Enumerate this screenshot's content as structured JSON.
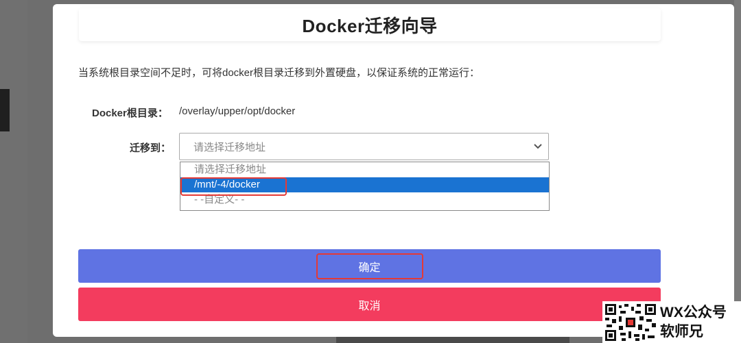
{
  "dialog": {
    "title": "Docker迁移向导",
    "description": "当系统根目录空间不足时，可将docker根目录迁移到外置硬盘，以保证系统的正常运行：",
    "root_label": "Docker根目录：",
    "root_value": "/overlay/upper/opt/docker",
    "migrate_label": "迁移到：",
    "select": {
      "placeholder": "请选择迁移地址",
      "options": [
        "请选择迁移地址",
        "/mnt/-4/docker",
        "- -自定义- -"
      ],
      "highlighted_option": "/mnt/-4/docker"
    },
    "confirm_label": "确定",
    "cancel_label": "取消"
  },
  "colors": {
    "confirm": "#5f73e3",
    "cancel": "#f33c5e",
    "option_selected": "#1a73d2",
    "annotation": "#e53935"
  },
  "watermark": {
    "line1": "WX公众号",
    "line2": "软师兄"
  }
}
